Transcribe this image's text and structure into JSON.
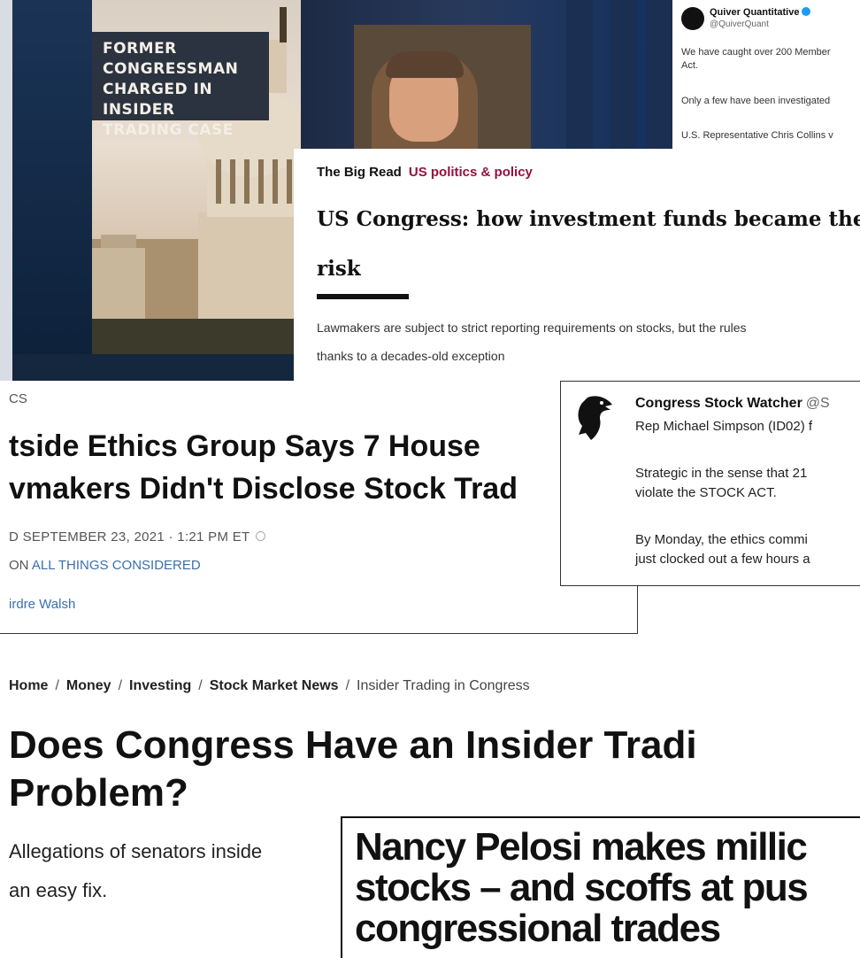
{
  "tv_banner": {
    "line1": "FORMER CONGRESSMAN",
    "line2": "CHARGED IN INSIDER",
    "line3": "TRADING CASE"
  },
  "tweet_quiver": {
    "name": "Quiver Quantitative",
    "handle": "@QuiverQuant",
    "line1": "We have caught over 200 Member",
    "line2": "Act.",
    "line3": "Only a few have been investigated",
    "line4": "U.S. Representative Chris Collins v"
  },
  "ft_article": {
    "kicker": "The Big Read",
    "section": "US politics & policy",
    "headline_line1": "US Congress: how investment funds became the new",
    "headline_line2": "risk",
    "standfirst_line1": "Lawmakers are subject to strict reporting requirements on stocks, but the rules",
    "standfirst_line2": "thanks to a decades-old exception"
  },
  "npr_article": {
    "section": "CS",
    "headline_line1": "tside Ethics Group Says 7 House",
    "headline_line2": "vmakers Didn't Disclose Stock Trad",
    "date": "D SEPTEMBER 23, 2021 · 1:21 PM ET",
    "heard_prefix": "ON",
    "program": "ALL THINGS CONSIDERED",
    "author": "irdre Walsh"
  },
  "tweet_csw": {
    "name": "Congress Stock Watcher",
    "handle": "@S",
    "line1": "Rep Michael Simpson (ID02) f",
    "line2": "Strategic in the sense that 21",
    "line3": "violate the STOCK ACT.",
    "line4": "By Monday, the ethics commi",
    "line5": "just clocked out a few hours a"
  },
  "money_article": {
    "breadcrumb": [
      "Home",
      "Money",
      "Investing",
      "Stock Market News"
    ],
    "breadcrumb_current": "Insider Trading in Congress",
    "separator": "/",
    "headline_line1": "Does Congress Have an Insider Tradi",
    "headline_line2": "Problem?",
    "sub_line1": "Allegations of senators inside",
    "sub_line2": "an easy fix."
  },
  "pelosi_article": {
    "line1": "Nancy Pelosi makes millic",
    "line2": "stocks – and scoffs at pus",
    "line3": "congressional trades"
  },
  "colors": {
    "ft_section": "#990f3d",
    "npr_link": "#3a6fb0",
    "twitter_verified": "#1d9bf0"
  }
}
